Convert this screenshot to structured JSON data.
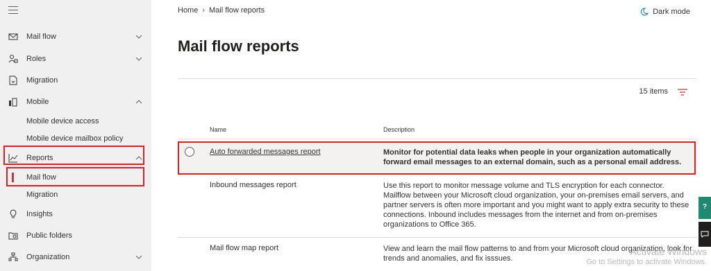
{
  "sidebar": {
    "items": [
      {
        "label": "Mail flow",
        "icon": "mail-icon"
      },
      {
        "label": "Roles",
        "icon": "roles-icon"
      },
      {
        "label": "Migration",
        "icon": "migration-icon"
      },
      {
        "label": "Mobile",
        "icon": "mobile-icon"
      },
      {
        "label": "Reports",
        "icon": "reports-icon"
      },
      {
        "label": "Insights",
        "icon": "insights-icon"
      },
      {
        "label": "Public folders",
        "icon": "public-folders-icon"
      },
      {
        "label": "Organization",
        "icon": "organization-icon"
      }
    ],
    "mobile_sub": [
      "Mobile device access",
      "Mobile device mailbox policy"
    ],
    "reports_sub": [
      "Mail flow",
      "Migration"
    ]
  },
  "header": {
    "breadcrumb": [
      "Home",
      "Mail flow reports"
    ],
    "dark_mode": "Dark mode"
  },
  "main": {
    "title": "Mail flow reports",
    "count": "15 items",
    "columns": {
      "name": "Name",
      "description": "Description"
    },
    "rows": [
      {
        "name": "Auto forwarded messages report",
        "desc": "Monitor for potential data leaks when people in your organization automatically forward email messages to an external domain, such as a personal email address."
      },
      {
        "name": "Inbound messages report",
        "desc": "Use this report to monitor message volume and TLS encryption for each connector. Mailflow between your Microsoft cloud organization, your on-premises email servers, and partner servers is often more important and you might want to apply extra security to these connections. Inbound includes messages from the internet and from on-premises organizations to Office 365."
      },
      {
        "name": "Mail flow map report",
        "desc": "View and learn the mail flow patterns to and from your Microsoft cloud organization, look for trends and anomalies, and fix isssues."
      }
    ]
  },
  "watermark": {
    "line1": "Activate Windows",
    "line2": "Go to Settings to activate Windows."
  },
  "colors": {
    "accent": "#d13438",
    "highlight_box": "#e02020",
    "side_tab": "#1f8a70"
  }
}
